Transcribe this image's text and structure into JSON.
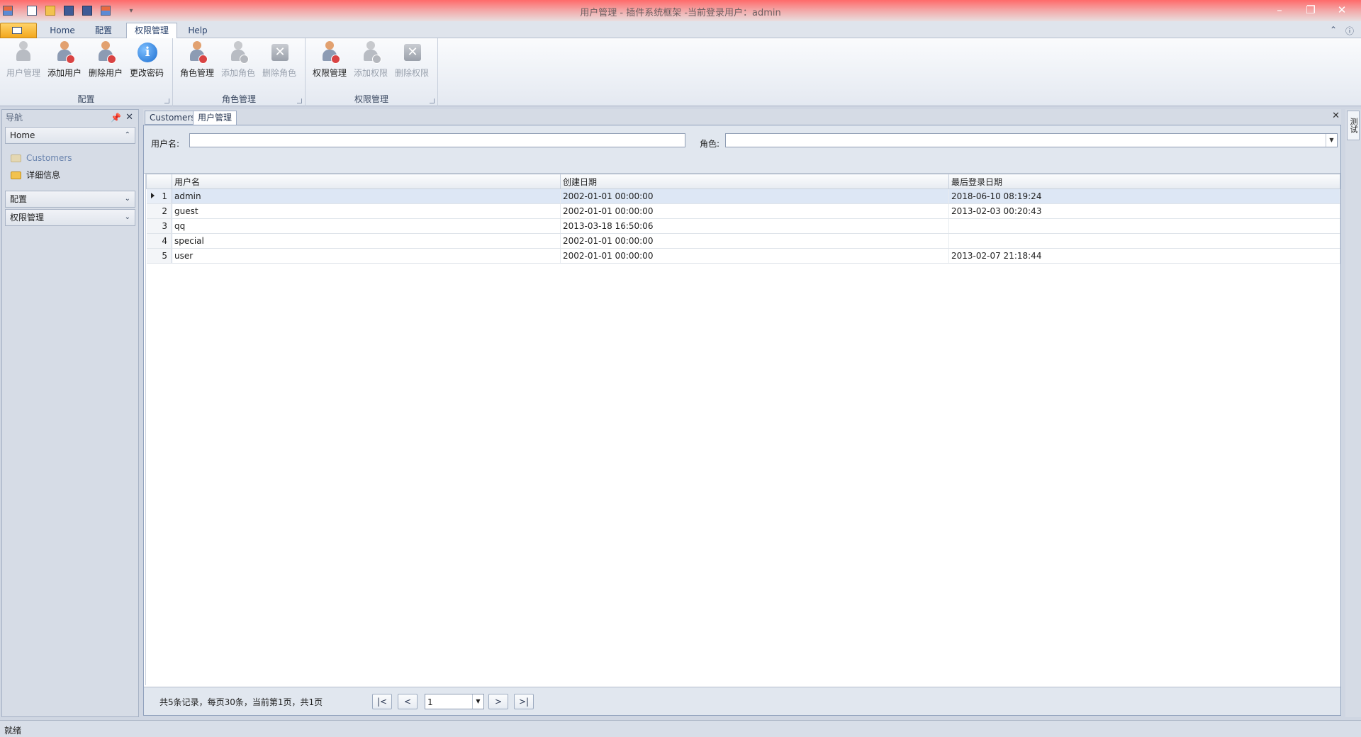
{
  "window": {
    "title": "用户管理 - 插件系统框架 -当前登录用户：admin",
    "quick_access": [
      "new-icon",
      "open-icon",
      "save-icon",
      "save-all-icon",
      "grid-icon"
    ]
  },
  "ribbon": {
    "tabs": [
      "Home",
      "配置",
      "权限管理",
      "Help"
    ],
    "active_tab": "权限管理",
    "groups": [
      {
        "caption": "配置",
        "buttons": [
          {
            "label": "用户管理",
            "icon": "user-icon",
            "enabled": false
          },
          {
            "label": "添加用户",
            "icon": "add-user-icon",
            "enabled": true
          },
          {
            "label": "删除用户",
            "icon": "delete-user-icon",
            "enabled": true
          },
          {
            "label": "更改密码",
            "icon": "info-icon",
            "enabled": true
          }
        ]
      },
      {
        "caption": "角色管理",
        "buttons": [
          {
            "label": "角色管理",
            "icon": "role-icon",
            "enabled": true
          },
          {
            "label": "添加角色",
            "icon": "add-role-icon",
            "enabled": false
          },
          {
            "label": "删除角色",
            "icon": "delete-icon",
            "enabled": false
          }
        ]
      },
      {
        "caption": "权限管理",
        "buttons": [
          {
            "label": "权限管理",
            "icon": "permission-icon",
            "enabled": true
          },
          {
            "label": "添加权限",
            "icon": "add-permission-icon",
            "enabled": false
          },
          {
            "label": "删除权限",
            "icon": "delete-icon",
            "enabled": false
          }
        ]
      }
    ]
  },
  "nav": {
    "title": "导航",
    "groups": [
      "Home",
      "配置",
      "权限管理"
    ],
    "home_items": [
      {
        "label": "Customers",
        "icon": "folder-icon"
      },
      {
        "label": "详细信息",
        "icon": "folder-icon"
      }
    ]
  },
  "doc_tabs": [
    "Customers",
    "用户管理"
  ],
  "active_doc_tab": "用户管理",
  "filter": {
    "username_label": "用户名:",
    "username_value": "",
    "role_label": "角色:",
    "role_value": ""
  },
  "grid": {
    "columns": [
      "用户名",
      "创建日期",
      "最后登录日期"
    ],
    "rows": [
      {
        "num": "1",
        "username": "admin",
        "created": "2002-01-01 00:00:00",
        "last_login": "2018-06-10 08:19:24"
      },
      {
        "num": "2",
        "username": "guest",
        "created": "2002-01-01 00:00:00",
        "last_login": "2013-02-03 00:20:43"
      },
      {
        "num": "3",
        "username": "qq",
        "created": "2013-03-18 16:50:06",
        "last_login": ""
      },
      {
        "num": "4",
        "username": "special",
        "created": "2002-01-01 00:00:00",
        "last_login": ""
      },
      {
        "num": "5",
        "username": "user",
        "created": "2002-01-01 00:00:00",
        "last_login": "2013-02-07 21:18:44"
      }
    ],
    "selected_row": 1
  },
  "pager": {
    "summary": "共5条记录，每页30条，当前第1页，共1页",
    "first": "|<",
    "prev": "<",
    "page_value": "1",
    "next": ">",
    "last": ">|"
  },
  "right_dock": {
    "label": "测试"
  },
  "status": {
    "text": "就绪"
  }
}
